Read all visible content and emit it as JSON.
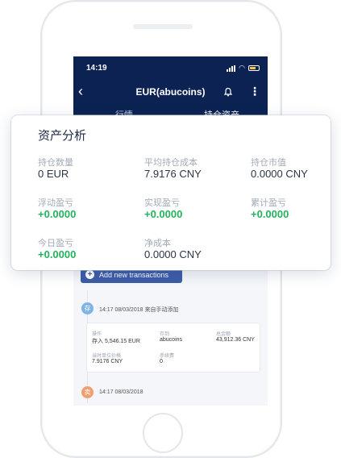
{
  "status_bar": {
    "time": "14:19"
  },
  "nav": {
    "title": "EUR(abucoins)"
  },
  "tabs": [
    {
      "label": "行情"
    },
    {
      "label": "持仓资产"
    }
  ],
  "analysis": {
    "title": "资产分析",
    "stats": [
      {
        "label": "持仓数量",
        "value": "0 EUR"
      },
      {
        "label": "平均持仓成本",
        "value": "7.9176 CNY"
      },
      {
        "label": "持仓市值",
        "value": "0.0000 CNY"
      },
      {
        "label": "浮动盈亏",
        "value": "+0.0000"
      },
      {
        "label": "实现盈亏",
        "value": "+0.0000"
      },
      {
        "label": "累计盈亏",
        "value": "+0.0000"
      },
      {
        "label": "今日盈亏",
        "value": "+0.0000"
      },
      {
        "label": "净成本",
        "value": "0.0000 CNY"
      }
    ]
  },
  "add_transaction": {
    "label": "Add new transactions"
  },
  "timeline": [
    {
      "badge": "存",
      "text": "14:17 08/03/2018 来自手动添加"
    },
    {
      "badge": "卖",
      "text": "14:17 08/03/2018"
    }
  ],
  "transaction": {
    "fields": [
      {
        "label": "操作",
        "value": "存入 5,546.15 EUR"
      },
      {
        "label": "存到",
        "value": "abucoins"
      },
      {
        "label": "总金额",
        "value": "43,912.36 CNY"
      },
      {
        "label": "当时单位价格",
        "value": "7.9176 CNY"
      },
      {
        "label": "手续费",
        "value": "0"
      }
    ]
  },
  "colors": {
    "header_bg": "#0b2253",
    "positive": "#23b35b",
    "button": "#3d5ca8"
  }
}
